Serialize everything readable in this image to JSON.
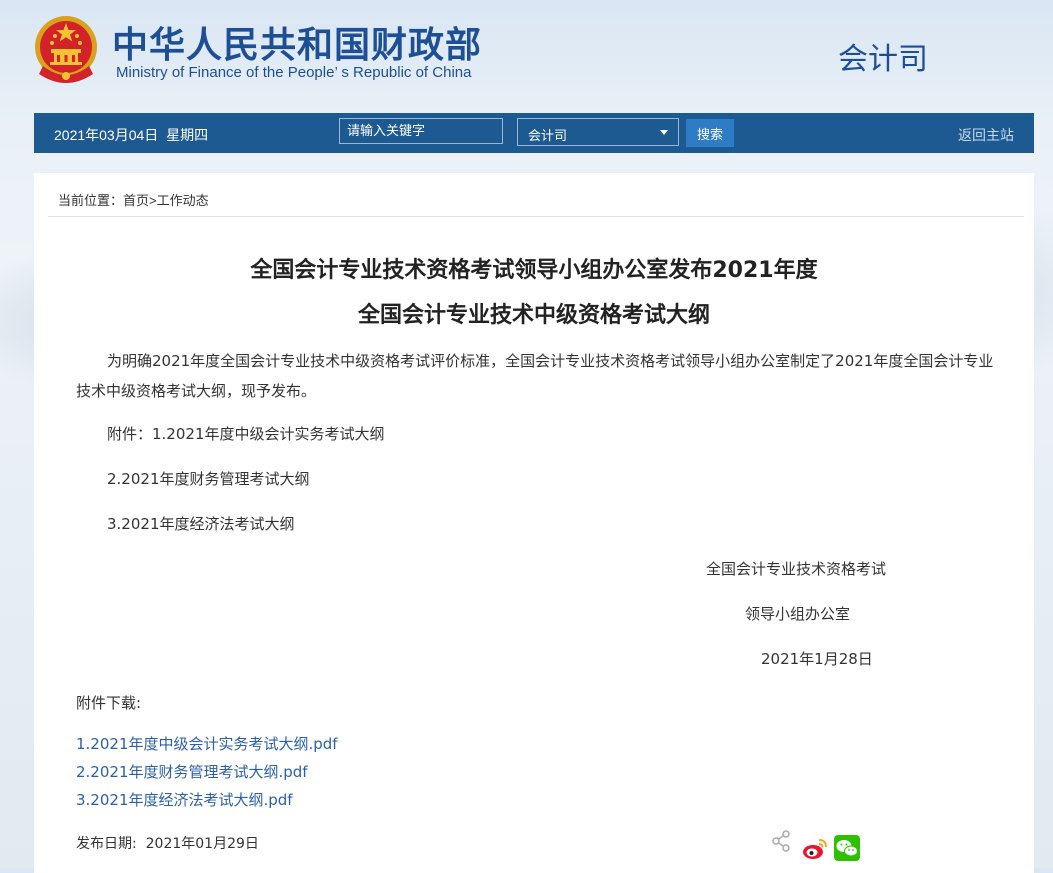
{
  "header": {
    "title_cn": "中华人民共和国财政部",
    "title_en": "Ministry of Finance of the People’ s Republic of China",
    "department": "会计司"
  },
  "navbar": {
    "date": "2021年03月04日",
    "weekday": "星期四",
    "search_placeholder": "请输入关键字",
    "select_value": "会计司",
    "search_button": "搜索",
    "home_link": "返回主站"
  },
  "breadcrumb": {
    "prefix": "当前位置：",
    "home": "首页",
    "sep": ">",
    "current": "工作动态"
  },
  "article": {
    "title_line1": "全国会计专业技术资格考试领导小组办公室发布2021年度",
    "title_line2": "全国会计专业技术中级资格考试大纲",
    "intro": "为明确2021年度全国会计专业技术中级资格考试评价标准，全国会计专业技术资格考试领导小组办公室制定了2021年度全国会计专业技术中级资格考试大纲，现予发布。",
    "attachment_1": "附件：1.2021年度中级会计实务考试大纲",
    "attachment_2": "2.2021年度财务管理考试大纲",
    "attachment_3": "3.2021年度经济法考试大纲",
    "signer_1": "全国会计专业技术资格考试",
    "signer_2": "领导小组办公室",
    "sign_date": "2021年1月28日"
  },
  "downloads": {
    "label": "附件下载:",
    "files": [
      "1.2021年度中级会计实务考试大纲.pdf",
      "2.2021年度财务管理考试大纲.pdf",
      "3.2021年度经济法考试大纲.pdf"
    ]
  },
  "footer": {
    "publish_label": "发布日期:",
    "publish_date": "2021年01月29日"
  },
  "icons": {
    "emblem": "national-emblem",
    "share": "share-icon",
    "weibo": "weibo-icon",
    "wechat": "wechat-icon"
  },
  "colors": {
    "brand_blue": "#1d4f97",
    "nav_bar": "#1e5a92",
    "search_button": "#2f7cc6",
    "link": "#2b5fab"
  }
}
